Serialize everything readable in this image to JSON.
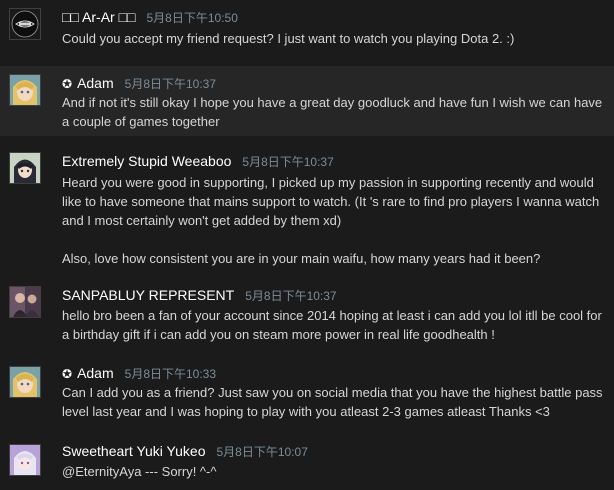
{
  "comments": [
    {
      "author": "□□ Ar-Ar □□",
      "timestamp": "5月8日下午10:50",
      "avatar_icon": "marquee-logo-avatar",
      "text": "Could you accept my friend request? I just want to watch you playing Dota 2. :)"
    },
    {
      "author": "Adam",
      "badge_icon": "star-badge-icon",
      "badge_glyph": "✪",
      "timestamp": "5月8日下午10:37",
      "avatar_icon": "anime-blonde-avatar",
      "text": "And if not it's still okay I hope you have a great day goodluck and have fun I wish we can have a couple of games together"
    },
    {
      "author": "Extremely Stupid Weeaboo",
      "timestamp": "5月8日下午10:37",
      "avatar_icon": "anime-darkhair-avatar",
      "text": "Heard you were good in supporting, I picked up my passion in supporting recently and would like to have someone that mains support to watch. (It 's rare to find pro players I wanna watch and I most certainly won't get added by them xd)",
      "text2": "Also, love how consistent you are in your main waifu, how many years had it been?"
    },
    {
      "author": "SANPABLUY REPRESENT",
      "timestamp": "5月8日下午10:37",
      "avatar_icon": "photo-avatar",
      "text": "hello bro been a fan of your account since 2014 hoping at least i can add you lol itll be cool for a birthday gift if i can add you on steam more power in real life goodhealth !"
    },
    {
      "author": "Adam",
      "badge_icon": "star-badge-icon",
      "badge_glyph": "✪",
      "timestamp": "5月8日下午10:33",
      "avatar_icon": "anime-blonde-avatar",
      "text": "Can I add you as a friend? Just saw you on social media that you have the highest battle pass level last year and I was hoping to play with you atleast 2-3 games atleast Thanks <3"
    },
    {
      "author": "Sweetheart Yuki Yukeo",
      "timestamp": "5月8日下午10:07",
      "avatar_icon": "anime-purple-avatar",
      "text": "@EternityAya --- Sorry! ^-^"
    }
  ],
  "colors": {
    "background": "#1b1b1b",
    "highlight": "#262626",
    "author": "#ffffff",
    "timestamp": "#7f8c96",
    "text": "#d6d6d6"
  }
}
